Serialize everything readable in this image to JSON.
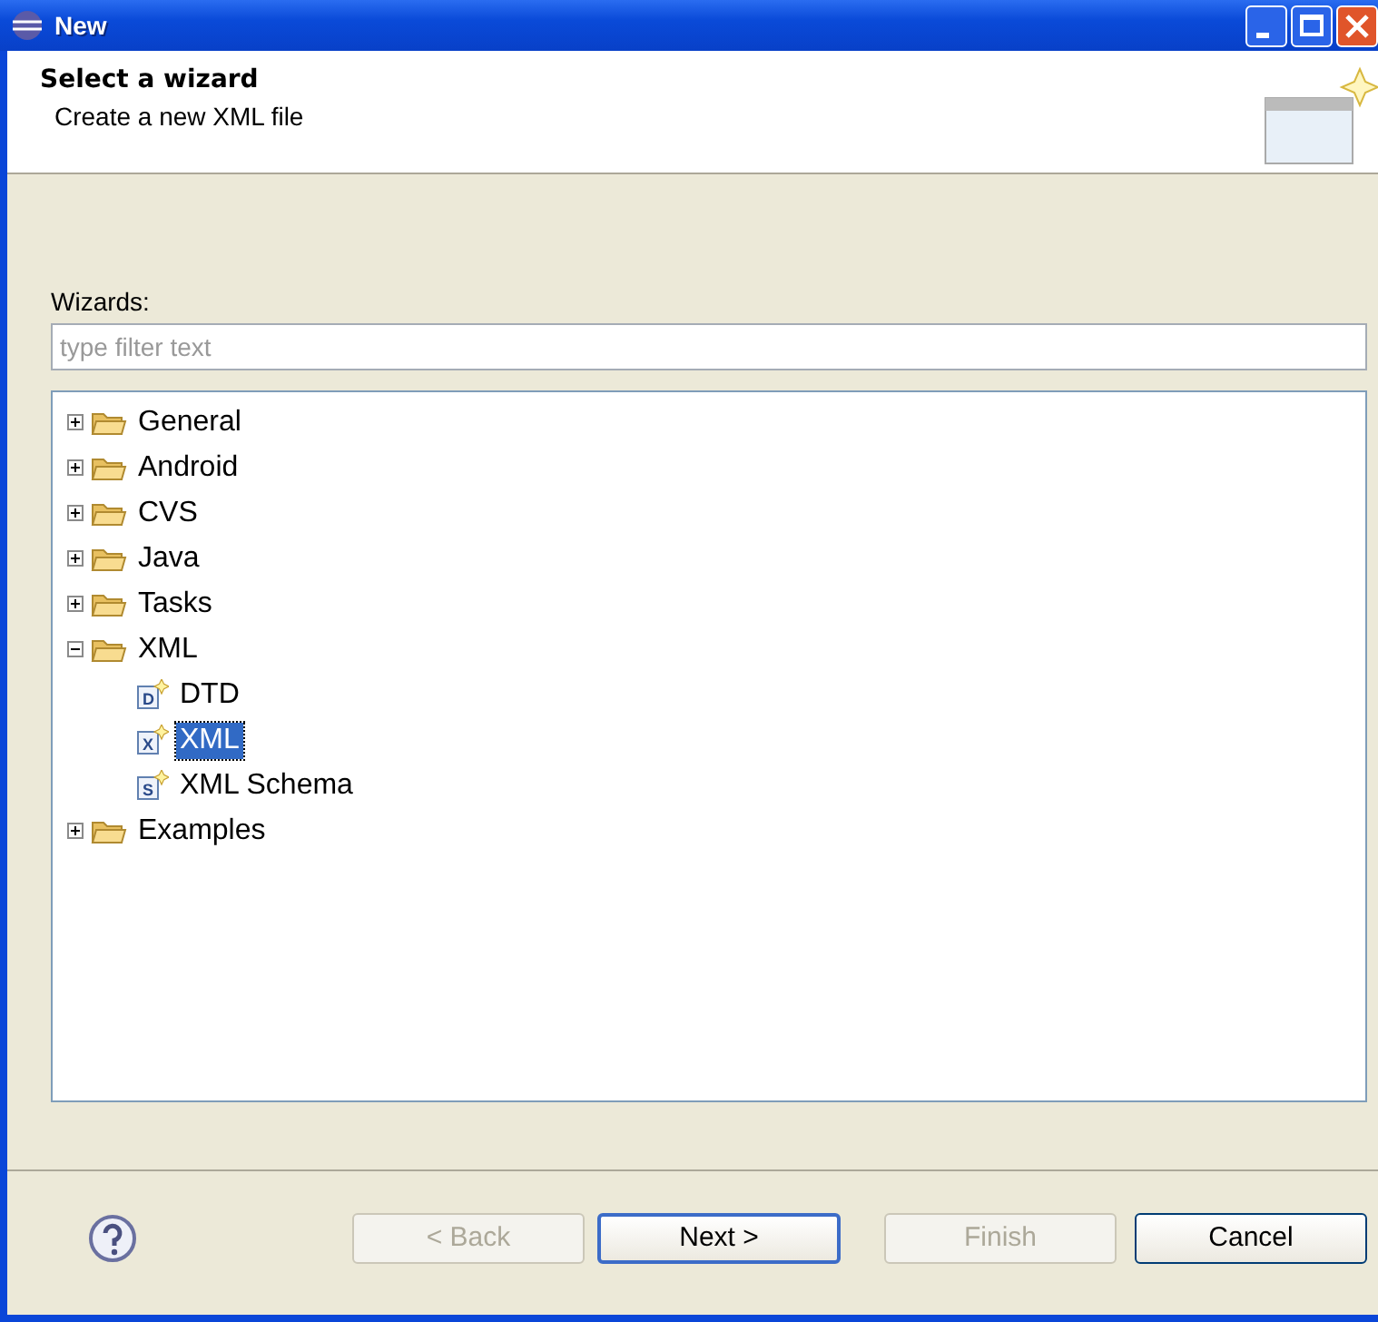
{
  "window": {
    "title": "New"
  },
  "header": {
    "title": "Select a wizard",
    "description": "Create a new XML file"
  },
  "wizards_label": "Wizards:",
  "filter": {
    "placeholder": "type filter text"
  },
  "tree": [
    {
      "label": "General",
      "kind": "folder",
      "expanded": false,
      "selected": false
    },
    {
      "label": "Android",
      "kind": "folder",
      "expanded": false,
      "selected": false
    },
    {
      "label": "CVS",
      "kind": "folder",
      "expanded": false,
      "selected": false
    },
    {
      "label": "Java",
      "kind": "folder",
      "expanded": false,
      "selected": false
    },
    {
      "label": "Tasks",
      "kind": "folder",
      "expanded": false,
      "selected": false
    },
    {
      "label": "XML",
      "kind": "folder",
      "expanded": true,
      "selected": false,
      "children": [
        {
          "label": "DTD",
          "kind": "file",
          "icon_letter": "D",
          "selected": false
        },
        {
          "label": "XML",
          "kind": "file",
          "icon_letter": "X",
          "selected": true
        },
        {
          "label": "XML Schema",
          "kind": "file",
          "icon_letter": "S",
          "selected": false
        }
      ]
    },
    {
      "label": "Examples",
      "kind": "folder",
      "expanded": false,
      "selected": false
    }
  ],
  "buttons": [
    {
      "label": "< Back",
      "disabled": true,
      "default": false
    },
    {
      "label": "Next >",
      "disabled": false,
      "default": true
    },
    {
      "label": "Finish",
      "disabled": true,
      "default": false
    },
    {
      "label": "Cancel",
      "disabled": false,
      "default": false
    }
  ]
}
